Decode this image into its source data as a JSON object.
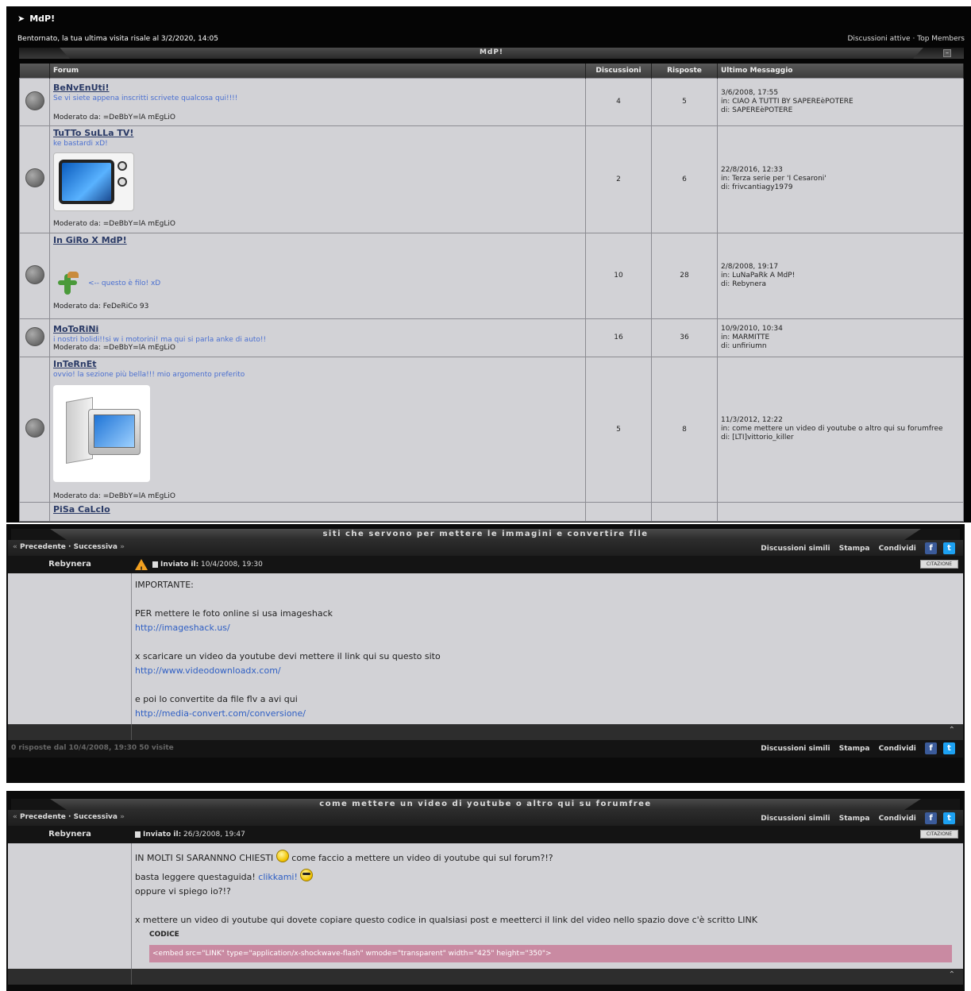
{
  "header": {
    "brand": "MdP!",
    "welcome": "Bentornato, la tua ultima visita risale al 3/2/2020, 14:05",
    "active_discussions": "Discussioni attive",
    "separator": "·",
    "top_members": "Top Members"
  },
  "forum_table": {
    "title": "MdP!",
    "columns": {
      "forum": "Forum",
      "discussions": "Discussioni",
      "replies": "Risposte",
      "last": "Ultimo Messaggio"
    },
    "rows": [
      {
        "name": "BeNvEnUti!",
        "desc": "Se vi siete appena inscritti scrivete qualcosa qui!!!!",
        "mod": "Moderato da: =DeBbY=lA mEgLiO",
        "discussions": "4",
        "replies": "5",
        "last_date": "3/6/2008, 17:55",
        "last_in": "in: CIAO A TUTTI BY SAPEREèPOTERE",
        "last_by": "di: SAPEREèPOTERE"
      },
      {
        "name": "TuTTo SuLLa TV!",
        "desc": "ke bastardi xD!",
        "mod": "Moderato da: =DeBbY=lA mEgLiO",
        "discussions": "2",
        "replies": "6",
        "last_date": "22/8/2016, 12:33",
        "last_in": "in: Terza serie per 'I Cesaroni'",
        "last_by": "di: frivcantiagy1979"
      },
      {
        "name": "In GiRo X MdP!",
        "desc": "<-- questo è filo! xD",
        "mod": "Moderato da: FeDeRiCo 93",
        "discussions": "10",
        "replies": "28",
        "last_date": "2/8/2008, 19:17",
        "last_in": "in: LuNaPaRk A MdP!",
        "last_by": "di: Rebynera"
      },
      {
        "name": "MoToRiNi",
        "desc": "i nostri bolidi!!si w i motorini! ma qui si parla anke di auto!!",
        "mod": "Moderato da: =DeBbY=lA mEgLiO",
        "discussions": "16",
        "replies": "36",
        "last_date": "10/9/2010, 10:34",
        "last_in": "in: MARMITTE",
        "last_by": "di: unfiriumn"
      },
      {
        "name": "InTeRnEt",
        "desc": "ovvio! la sezione più bella!!! mio argomento preferito",
        "mod": "Moderato da: =DeBbY=lA mEgLiO",
        "discussions": "5",
        "replies": "8",
        "last_date": "11/3/2012, 12:22",
        "last_in": "in: come mettere un video di youtube o altro qui su forumfree",
        "last_by": "di: [LTI]vittorio_killer"
      },
      {
        "name": "PiSa CaLcIo"
      }
    ]
  },
  "topic1": {
    "title": "siti che servono per mettere le immagini e convertire file",
    "prev": "Precedente",
    "next": "Successiva",
    "similar": "Discussioni simili",
    "print": "Stampa",
    "share": "Condividi",
    "author": "Rebynera",
    "sent_label": "Inviato il:",
    "sent_date": "10/4/2008, 19:30",
    "quote": "CITAZIONE",
    "line1": "IMPORTANTE:",
    "line2": "PER mettere le foto online si usa imageshack",
    "link1": "http://imageshack.us/",
    "line3": "x scaricare un video da youtube devi mettere il link qui su questo sito",
    "link2": "http://www.videodownloadx.com/",
    "line4": "e poi lo convertite da file flv a avi qui",
    "link3": "http://media-convert.com/conversione/",
    "stats": "0 risposte dal 10/4/2008, 19:30   50 visite"
  },
  "topic2": {
    "title": "come mettere un video di youtube o altro qui su forumfree",
    "prev": "Precedente",
    "next": "Successiva",
    "similar": "Discussioni simili",
    "print": "Stampa",
    "share": "Condividi",
    "author": "Rebynera",
    "sent_label": "Inviato il:",
    "sent_date": "26/3/2008, 19:47",
    "quote": "CITAZIONE",
    "line1a": "IN MOLTI SI SARANNNO CHIESTI",
    "line1b": "come faccio a mettere un video di youtube qui sul forum?!?",
    "line2a": "basta leggere questaguida!",
    "link1": "clikkami!",
    "line3": "oppure vi spiego io?!?",
    "line4": "x mettere un video di youtube qui dovete copiare questo codice in qualsiasi post e meetterci il link del video nello spazio dove c'è scritto LINK",
    "code_title": "CODICE",
    "code": "<embed src=\"LINK\" type=\"application/x-shockwave-flash\" wmode=\"transparent\" width=\"425\" height=\"350\">"
  }
}
